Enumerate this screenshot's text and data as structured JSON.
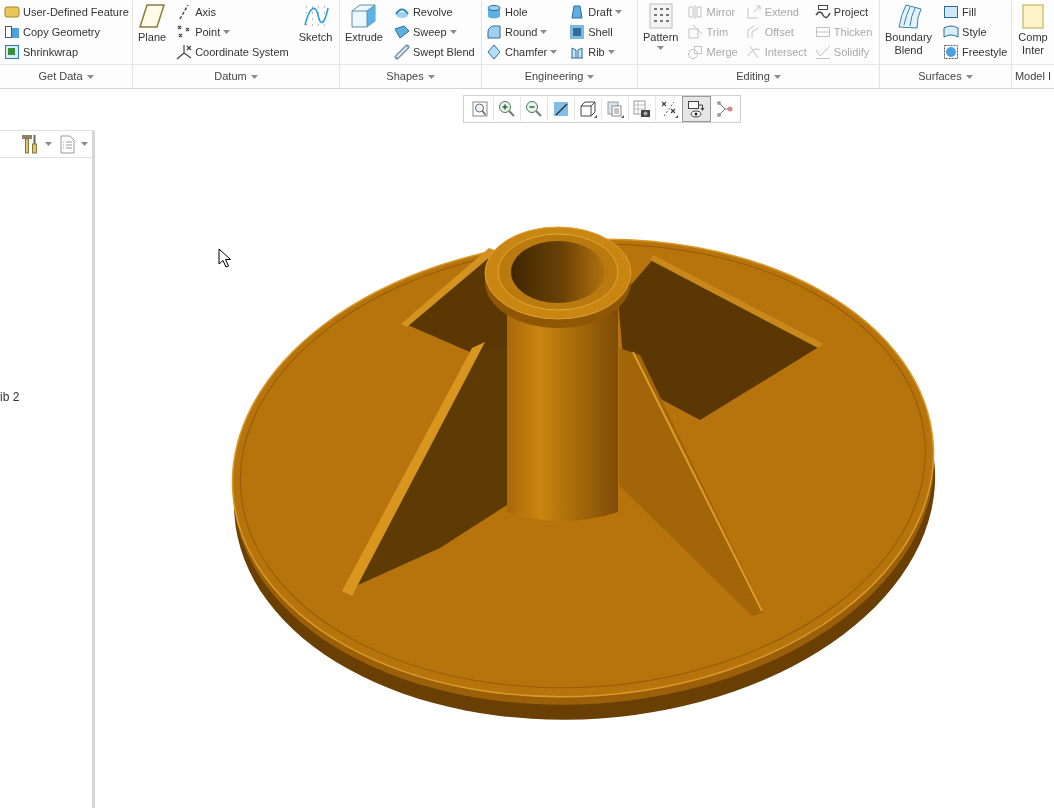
{
  "ribbon": {
    "groups": [
      {
        "label": "Get Data",
        "dropdown": true,
        "items": [
          {
            "kind": "stack",
            "buttons": [
              {
                "label": "User-Defined Feature",
                "dropdown": false,
                "disabled": false
              },
              {
                "label": "Copy Geometry",
                "dropdown": false,
                "disabled": false
              },
              {
                "label": "Shrinkwrap",
                "dropdown": false,
                "disabled": false
              }
            ]
          }
        ]
      },
      {
        "label": "Datum",
        "dropdown": true,
        "items": [
          {
            "kind": "large",
            "label": "Plane",
            "dropdown": false
          },
          {
            "kind": "stack",
            "buttons": [
              {
                "label": "Axis",
                "dropdown": false,
                "disabled": false
              },
              {
                "label": "Point",
                "dropdown": true,
                "disabled": false
              },
              {
                "label": "Coordinate System",
                "dropdown": false,
                "disabled": false
              }
            ]
          },
          {
            "kind": "large",
            "label": "Sketch",
            "dropdown": false
          }
        ]
      },
      {
        "label": "Shapes",
        "dropdown": true,
        "items": [
          {
            "kind": "large",
            "label": "Extrude",
            "dropdown": false
          },
          {
            "kind": "stack",
            "buttons": [
              {
                "label": "Revolve",
                "dropdown": false,
                "disabled": false
              },
              {
                "label": "Sweep",
                "dropdown": true,
                "disabled": false
              },
              {
                "label": "Swept Blend",
                "dropdown": false,
                "disabled": false
              }
            ]
          }
        ]
      },
      {
        "label": "Engineering",
        "dropdown": true,
        "items": [
          {
            "kind": "stack",
            "buttons": [
              {
                "label": "Hole",
                "dropdown": false,
                "disabled": false
              },
              {
                "label": "Round",
                "dropdown": true,
                "disabled": false
              },
              {
                "label": "Chamfer",
                "dropdown": true,
                "disabled": false
              }
            ]
          },
          {
            "kind": "stack",
            "buttons": [
              {
                "label": "Draft",
                "dropdown": true,
                "disabled": false
              },
              {
                "label": "Shell",
                "dropdown": false,
                "disabled": false
              },
              {
                "label": "Rib",
                "dropdown": true,
                "disabled": false
              }
            ]
          }
        ]
      },
      {
        "label": "Editing",
        "dropdown": true,
        "items": [
          {
            "kind": "large",
            "label": "Pattern",
            "dropdown": true
          },
          {
            "kind": "stack",
            "buttons": [
              {
                "label": "Mirror",
                "dropdown": false,
                "disabled": true
              },
              {
                "label": "Trim",
                "dropdown": false,
                "disabled": true
              },
              {
                "label": "Merge",
                "dropdown": false,
                "disabled": true
              }
            ]
          },
          {
            "kind": "stack",
            "buttons": [
              {
                "label": "Extend",
                "dropdown": false,
                "disabled": true
              },
              {
                "label": "Offset",
                "dropdown": false,
                "disabled": true
              },
              {
                "label": "Intersect",
                "dropdown": false,
                "disabled": true
              }
            ]
          },
          {
            "kind": "stack",
            "buttons": [
              {
                "label": "Project",
                "dropdown": false,
                "disabled": false
              },
              {
                "label": "Thicken",
                "dropdown": false,
                "disabled": true
              },
              {
                "label": "Solidify",
                "dropdown": false,
                "disabled": true
              }
            ]
          }
        ]
      },
      {
        "label": "Surfaces",
        "dropdown": true,
        "items": [
          {
            "kind": "large",
            "label": "Boundary Blend",
            "dropdown": false
          },
          {
            "kind": "stack",
            "buttons": [
              {
                "label": "Fill",
                "dropdown": false,
                "disabled": false
              },
              {
                "label": "Style",
                "dropdown": false,
                "disabled": false
              },
              {
                "label": "Freestyle",
                "dropdown": false,
                "disabled": false
              }
            ]
          }
        ]
      },
      {
        "label": "Model I",
        "dropdown": false,
        "items": [
          {
            "kind": "large",
            "label": "Comp Inter",
            "dropdown": false
          }
        ]
      }
    ]
  },
  "view_toolbar": {
    "buttons": [
      {
        "selected": false
      },
      {
        "selected": false
      },
      {
        "selected": false
      },
      {
        "selected": false
      },
      {
        "selected": false
      },
      {
        "selected": false
      },
      {
        "selected": false
      },
      {
        "selected": false
      },
      {
        "selected": true
      },
      {
        "selected": false
      }
    ]
  },
  "model_tree": {
    "items": [
      {
        "label": "ib 2"
      }
    ]
  }
}
